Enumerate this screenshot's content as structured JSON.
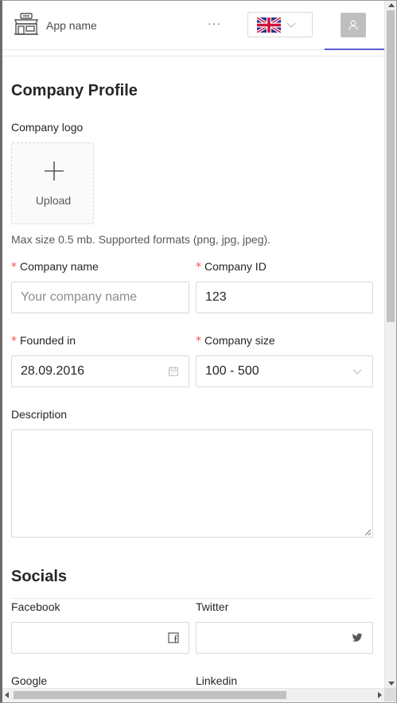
{
  "header": {
    "app_name": "App name",
    "more_label": "···",
    "language": {
      "icon": "uk-flag-icon",
      "selected": "English"
    },
    "active_tab_color": "#5b5bd6"
  },
  "page": {
    "title": "Company Profile",
    "logo": {
      "label": "Company logo",
      "upload_label": "Upload",
      "hint": "Max size 0.5 mb. Supported formats (png, jpg, jpeg)."
    },
    "fields": {
      "company_name": {
        "label": "Company name",
        "required": "*",
        "value": "",
        "placeholder": "Your company name"
      },
      "company_id": {
        "label": "Company ID",
        "required": "*",
        "value": "123"
      },
      "founded_in": {
        "label": "Founded in",
        "required": "*",
        "value": "28.09.2016"
      },
      "company_size": {
        "label": "Company size",
        "required": "*",
        "value": "100 - 500"
      },
      "description": {
        "label": "Description",
        "value": ""
      }
    },
    "socials": {
      "title": "Socials",
      "facebook": {
        "label": "Facebook",
        "value": ""
      },
      "twitter": {
        "label": "Twitter",
        "value": ""
      },
      "google": {
        "label": "Google"
      },
      "linkedin": {
        "label": "Linkedin"
      }
    }
  },
  "colors": {
    "required": "#ff4d4f",
    "border": "#d9d9d9",
    "accent": "#5b5bd6"
  }
}
